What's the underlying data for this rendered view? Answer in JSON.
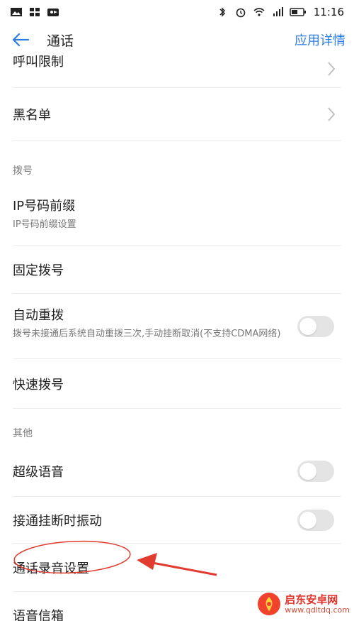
{
  "statusbar": {
    "time": "11:16",
    "left_icons": [
      "image-icon",
      "apps-icon",
      "bird-icon"
    ],
    "right_icons": [
      "bluetooth-icon",
      "alarm-icon",
      "wifi-icon",
      "signal-icon",
      "battery-icon"
    ]
  },
  "header": {
    "title": "通话",
    "detail_label": "应用详情"
  },
  "items": {
    "call_restriction": "呼叫限制",
    "blacklist": "黑名单",
    "section_dial": "拨号",
    "ip_prefix": {
      "label": "IP号码前缀",
      "sub": "IP号码前缀设置"
    },
    "fixed_dial": "固定拨号",
    "auto_redial": {
      "label": "自动重拨",
      "sub": "拨号未接通后系统自动重拨三次,手动挂断取消(不支持CDMA网络)",
      "on": false
    },
    "speed_dial": "快速拨号",
    "section_other": "其他",
    "super_voice": {
      "label": "超级语音",
      "on": false
    },
    "vibrate_on_connect": {
      "label": "接通挂断时振动",
      "on": false
    },
    "call_recording": "通话录音设置",
    "voicemail": "语音信箱"
  },
  "watermark": {
    "name": "启东安卓网",
    "url": "www.qdltdq.com"
  },
  "colors": {
    "accent": "#2f7de1",
    "annotation": "#e23b2f"
  }
}
